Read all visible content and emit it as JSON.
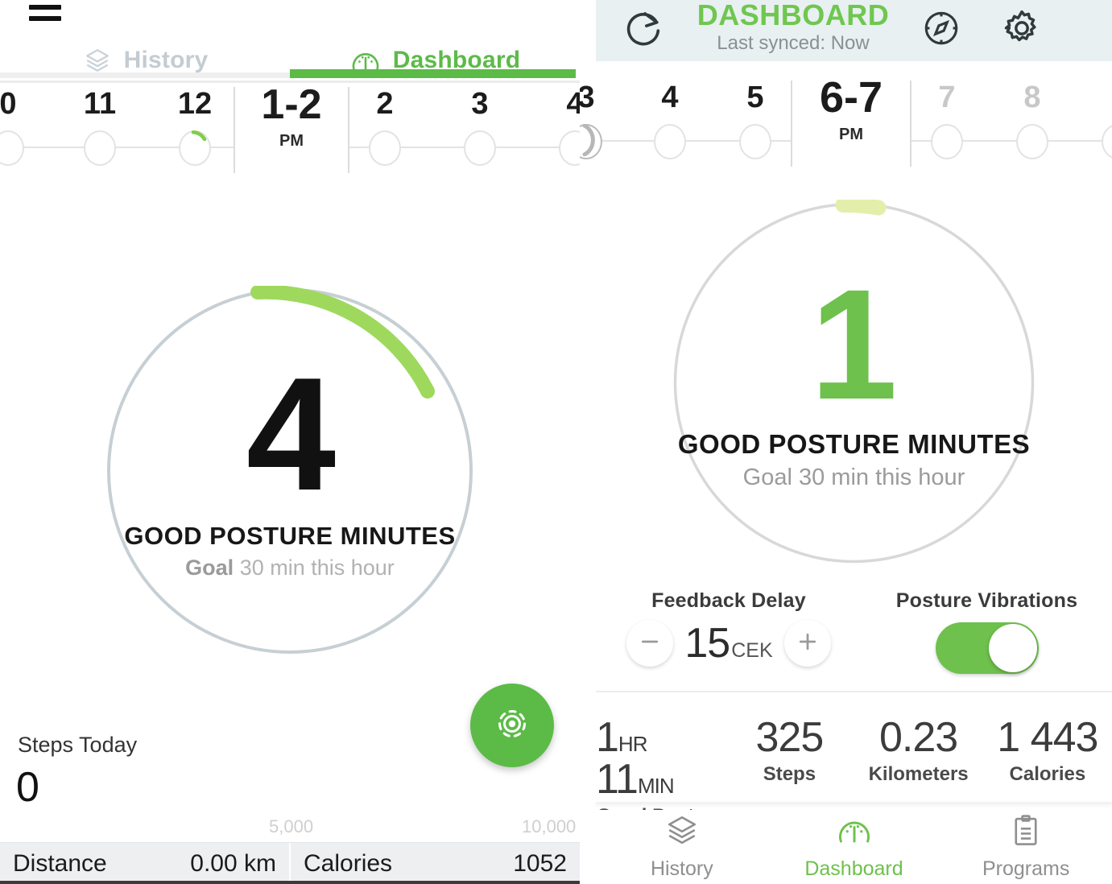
{
  "left": {
    "menu_icon": "hamburger-menu-icon",
    "tabs": [
      {
        "label": "History",
        "icon": "layers-icon",
        "active": false
      },
      {
        "label": "Dashboard",
        "icon": "gauge-icon",
        "active": true
      }
    ],
    "hours": {
      "before": [
        "0",
        "11",
        "12"
      ],
      "current": "1-2",
      "current_meridiem": "PM",
      "after": [
        "2",
        "3",
        "4"
      ]
    },
    "ring": {
      "value": "4",
      "title": "GOOD POSTURE MINUTES",
      "goal_prefix": "Goal",
      "goal_text": "30 min this hour",
      "progress_percent": 17,
      "track_color": "#c6cfd4",
      "fill_color": "#9ed95e"
    },
    "fab": {
      "icon": "calibrate-target-icon",
      "color": "#5cbb47"
    },
    "steps": {
      "label": "Steps Today",
      "value": "0",
      "grid_mid": "5,000",
      "grid_max": "10,000"
    },
    "bottom_bar": [
      {
        "label": "Distance",
        "value": "0.00 km"
      },
      {
        "label": "Calories",
        "value": "1052"
      }
    ]
  },
  "right": {
    "header": {
      "refresh_icon": "refresh-icon",
      "title": "DASHBOARD",
      "subtitle": "Last synced: Now",
      "compass_icon": "compass-icon",
      "gear_icon": "gear-icon",
      "title_color": "#6fc74f",
      "bg_color": "#e9f0f1"
    },
    "hours": {
      "before": [
        "3",
        "4",
        "5"
      ],
      "current": "6-7",
      "current_meridiem": "PM",
      "after": [
        "7",
        "8"
      ]
    },
    "ring": {
      "value": "1",
      "title": "GOOD POSTURE MINUTES",
      "goal_text": "Goal 30 min this hour",
      "progress_percent": 4,
      "track_color": "#d8d8d8",
      "fill_color": "#e4eeab",
      "value_color": "#6ec14c"
    },
    "controls": {
      "feedback_delay": {
        "label": "Feedback Delay",
        "minus_icon": "minus-icon",
        "plus_icon": "plus-icon",
        "value": "15",
        "unit": "CEK"
      },
      "posture_vibrations": {
        "label": "Posture Vibrations",
        "toggle_state": "on",
        "toggle_color": "#6ec14c"
      }
    },
    "stats": [
      {
        "value_main": "1",
        "unit1": "HR",
        "value_second": "11",
        "unit2": "MIN",
        "name": "Good Posture"
      },
      {
        "value_main": "325",
        "name": "Steps"
      },
      {
        "value_main": "0.23",
        "name": "Kilometers"
      },
      {
        "value_main": "1 443",
        "name": "Calories"
      }
    ],
    "bottom_nav": [
      {
        "label": "History",
        "icon": "layers-icon",
        "active": false
      },
      {
        "label": "Dashboard",
        "icon": "gauge-icon",
        "active": true
      },
      {
        "label": "Programs",
        "icon": "clipboard-icon",
        "active": false
      }
    ]
  }
}
